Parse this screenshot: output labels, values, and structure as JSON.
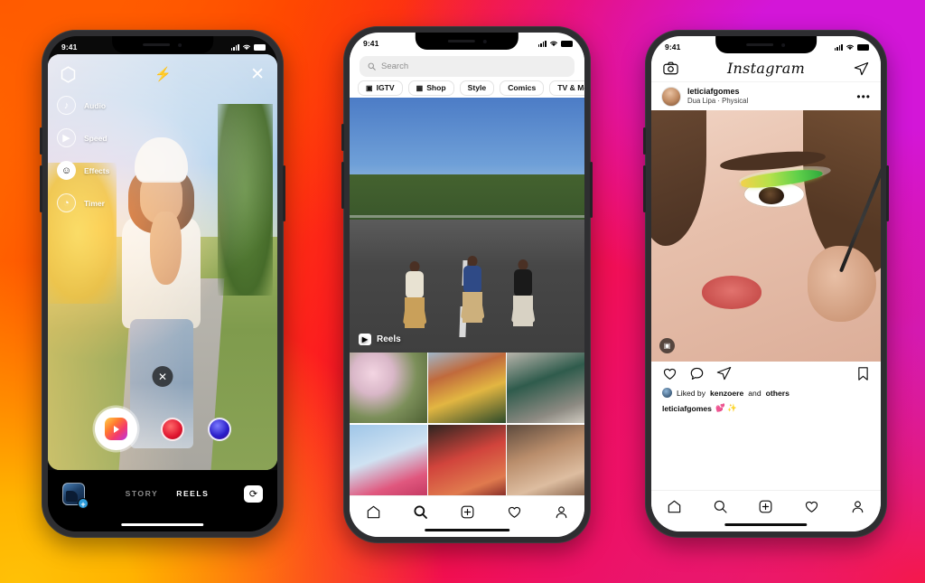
{
  "background": {
    "gradient_colors": [
      "#ff7a00",
      "#ff3d00",
      "#fb0f2e",
      "#e80f74",
      "#c81fd4",
      "#ffc107"
    ]
  },
  "phones": [
    {
      "id": "reels-camera",
      "status_bar": {
        "time": "9:41",
        "signal_icon": "cellular-bars-icon",
        "wifi_icon": "wifi-icon",
        "battery_icon": "battery-icon"
      },
      "camera": {
        "top_left_icon": "hexagon-filter-icon",
        "flash_icon": "flash-off-icon",
        "close_icon": "close-icon",
        "tools": [
          {
            "icon": "music-note-icon",
            "label": "Audio"
          },
          {
            "icon": "speed-gauge-icon",
            "label": "Speed"
          },
          {
            "icon": "smiley-effects-icon",
            "label": "Effects"
          },
          {
            "icon": "timer-icon",
            "label": "Timer"
          }
        ],
        "delete_clip_icon": "close-circle-icon",
        "shutter_icon": "reels-record-button",
        "effect_bubbles": [
          "effect-red-bubble",
          "effect-blue-bubble"
        ],
        "gallery_icon": "gallery-thumbnail",
        "gallery_badge": "+",
        "modes": [
          {
            "label": "STORY",
            "active": false
          },
          {
            "label": "REELS",
            "active": true
          }
        ],
        "flip_camera_icon": "flip-camera-icon"
      }
    },
    {
      "id": "explore",
      "status_bar": {
        "time": "9:41",
        "signal_icon": "cellular-bars-icon",
        "wifi_icon": "wifi-icon",
        "battery_icon": "battery-icon"
      },
      "search": {
        "placeholder": "Search",
        "icon": "search-icon"
      },
      "chips": [
        {
          "label": "IGTV",
          "icon": "igtv-icon"
        },
        {
          "label": "Shop",
          "icon": "shopping-bag-icon"
        },
        {
          "label": "Style",
          "icon": ""
        },
        {
          "label": "Comics",
          "icon": ""
        },
        {
          "label": "TV & Movies",
          "icon": ""
        }
      ],
      "featured": {
        "label": "Reels",
        "icon": "reels-icon"
      },
      "grid_tiles": [
        "cherry-blossom-photo",
        "two-friends-hugging-photo",
        "skateboard-street-photo",
        "pink-flower-photo",
        "red-jacket-photo",
        "portrait-photo"
      ],
      "tabbar": [
        {
          "name": "home",
          "icon": "home-icon",
          "active": false
        },
        {
          "name": "search",
          "icon": "search-icon",
          "active": true
        },
        {
          "name": "create",
          "icon": "plus-square-icon",
          "active": false
        },
        {
          "name": "activity",
          "icon": "heart-icon",
          "active": false
        },
        {
          "name": "profile",
          "icon": "person-icon",
          "active": false
        }
      ]
    },
    {
      "id": "feed",
      "status_bar": {
        "time": "9:41",
        "signal_icon": "cellular-bars-icon",
        "wifi_icon": "wifi-icon",
        "battery_icon": "battery-icon"
      },
      "header": {
        "camera_icon": "camera-icon",
        "title": "Instagram",
        "direct_icon": "direct-share-icon"
      },
      "post": {
        "username": "leticiafgomes",
        "music": "Dua Lipa · Physical",
        "more_icon": "more-options-icon",
        "media_badge_icon": "reels-badge-icon",
        "actions": {
          "like_icon": "heart-icon",
          "comment_icon": "comment-icon",
          "share_icon": "share-icon",
          "save_icon": "bookmark-icon"
        },
        "likes_prefix": "Liked by",
        "likes_user": "kenzoere",
        "likes_mid": "and",
        "likes_suffix": "others",
        "caption_user": "leticiafgomes",
        "caption_text": "💕 ✨"
      },
      "tabbar": [
        {
          "name": "home",
          "icon": "home-icon",
          "active": false
        },
        {
          "name": "search",
          "icon": "search-icon",
          "active": false
        },
        {
          "name": "create",
          "icon": "plus-square-icon",
          "active": false
        },
        {
          "name": "activity",
          "icon": "heart-icon",
          "active": false
        },
        {
          "name": "profile",
          "icon": "person-icon",
          "active": false
        }
      ]
    }
  ]
}
